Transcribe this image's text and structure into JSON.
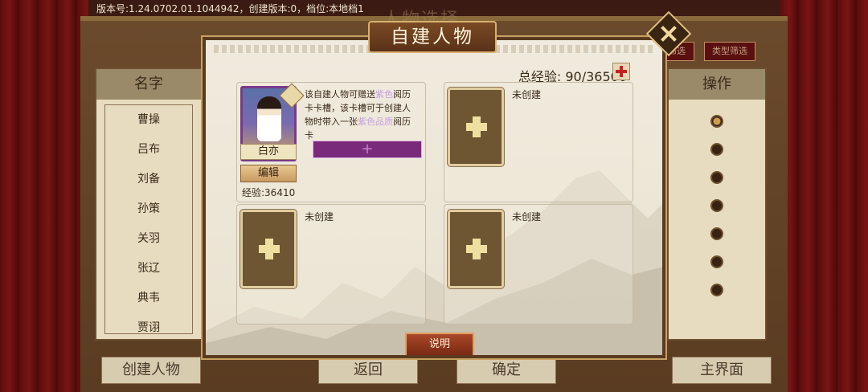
{
  "version_text": "版本号:1.24.0702.01.1044942，创建版本:0，档位:本地档1",
  "background": {
    "title": "人物选择",
    "list_header": "名字",
    "names": [
      "曹操",
      "吕布",
      "刘备",
      "孙策",
      "关羽",
      "张辽",
      "典韦",
      "贾诩"
    ],
    "action_header": "操作",
    "filter_buttons": [
      "筛选",
      "类型筛选"
    ],
    "bottom_buttons": [
      "创建人物",
      "返回",
      "确定",
      "主界面"
    ]
  },
  "modal": {
    "title": "自建人物",
    "total_exp_label": "总经验:",
    "total_exp_value": "90/36500",
    "created_slot": {
      "hero_name": "白亦",
      "edit_label": "编辑",
      "exp_text": "经验:36410",
      "gift_desc_1": "该自建人物可赠送",
      "gift_hl_1": "紫色",
      "gift_desc_2": "阅历卡卡槽，该卡槽可于创建人物时带入一张",
      "gift_hl_2": "紫色品质",
      "gift_desc_3": "阅历卡",
      "purple_slot_symbol": "+"
    },
    "empty_slot_status": "未创建",
    "explain_button": "说明"
  },
  "icons": {
    "close": "close-icon",
    "add_exp": "plus-icon",
    "add_card": "plus-icon"
  },
  "colors": {
    "accent_red": "#c82020",
    "purple_slot": "#7a2a7a",
    "modal_border": "#c8a060"
  }
}
